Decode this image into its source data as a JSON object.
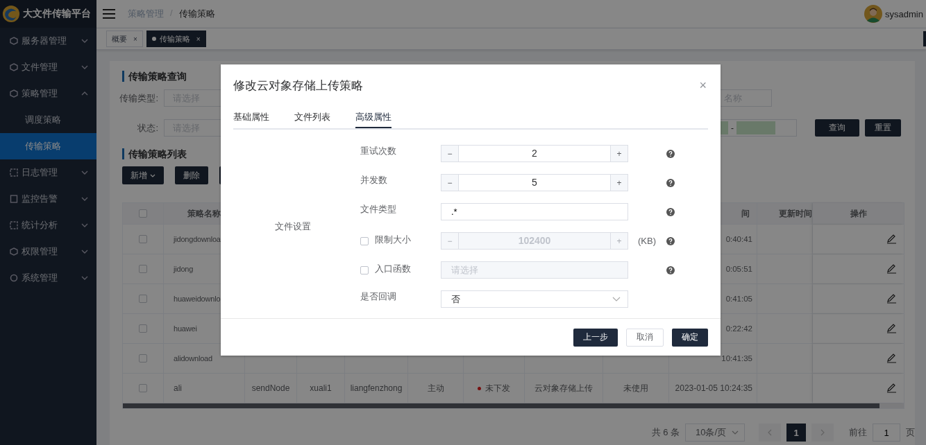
{
  "app": {
    "title": "大文件传输平台"
  },
  "sidebar": {
    "items": [
      {
        "label": "服务器管理",
        "expanded": false
      },
      {
        "label": "文件管理",
        "expanded": false
      },
      {
        "label": "策略管理",
        "expanded": true,
        "children": [
          {
            "label": "调度策略",
            "selected": false
          },
          {
            "label": "传输策略",
            "selected": true
          }
        ]
      },
      {
        "label": "日志管理",
        "expanded": false
      },
      {
        "label": "监控告警",
        "expanded": false
      },
      {
        "label": "统计分析",
        "expanded": false
      },
      {
        "label": "权限管理",
        "expanded": false
      },
      {
        "label": "系统管理",
        "expanded": false
      }
    ]
  },
  "header": {
    "breadcrumb": [
      "策略管理",
      "传输策略"
    ],
    "separator": "/",
    "user": "sysadmin"
  },
  "page_tabs": [
    {
      "label": "概要",
      "selected": false,
      "close": "×"
    },
    {
      "label": "传输策略",
      "selected": true,
      "close": "×"
    }
  ],
  "query": {
    "title": "传输策略查询",
    "type_label": "传输类型:",
    "type_placeholder": "请选择",
    "status_label": "状态:",
    "status_placeholder": "请选择",
    "name_placeholder": "名称",
    "range_separator": "-",
    "buttons": [
      "查询",
      "重置"
    ]
  },
  "list": {
    "title": "传输策略列表",
    "buttons": [
      {
        "label": "新增",
        "menu": true,
        "kind": "dark"
      },
      {
        "label": "删除",
        "menu": false,
        "kind": "dark"
      },
      {
        "kind": "dark"
      }
    ]
  },
  "table": {
    "header": {
      "name": "策略名称",
      "column_10": "间",
      "column_11": "更新时间",
      "column_12": "操作"
    },
    "all_selected": false,
    "rows": [
      {
        "selected": false,
        "name": "jidongdownloa",
        "column_10": "0:40:41"
      },
      {
        "selected": false,
        "name": "jidong",
        "column_10": "0:05:51"
      },
      {
        "selected": false,
        "name": "huaweidownlo",
        "column_10": "0:41:05"
      },
      {
        "selected": false,
        "name": "huawei",
        "column_10": "0:22:42"
      },
      {
        "selected": false,
        "name": "alidownload",
        "column_10": "10:41:35"
      },
      {
        "selected": false,
        "name": "ali",
        "column_3": "sendNode",
        "column_4": "xuali1",
        "column_5": "liangfenzhong",
        "column_6": "主动",
        "column_7": "未下发",
        "column_8": "云对象存储上传",
        "column_9": "未使用",
        "column_10": "2023-01-05 10:24:35"
      }
    ]
  },
  "pagination": {
    "total": "共 6 条",
    "page_size": "10条/页",
    "pages": [
      {
        "label": "1",
        "selected": true
      }
    ],
    "goto_label": "前往",
    "goto_value": "1",
    "goto_suffix": "页"
  },
  "dialog": {
    "title": "修改云对象存储上传策略",
    "close": "×",
    "tabs": [
      {
        "label": "基础属性",
        "selected": false
      },
      {
        "label": "文件列表",
        "selected": false
      },
      {
        "label": "高级属性",
        "selected": true
      }
    ],
    "group_label": "文件设置",
    "rows": [
      {
        "kind": "stepper",
        "label": "重试次数",
        "value": "2",
        "disabled": false,
        "minus": "−",
        "plus": "+",
        "help": true
      },
      {
        "kind": "stepper",
        "label": "并发数",
        "value": "5",
        "disabled": false,
        "minus": "−",
        "plus": "+",
        "help": true
      },
      {
        "kind": "input",
        "label": "文件类型",
        "value": ".*",
        "disabled": false,
        "help": true
      },
      {
        "kind": "stepper",
        "label": "限制大小",
        "checked": false,
        "value": "102400",
        "disabled": true,
        "unit": "(KB)",
        "minus": "−",
        "plus": "+",
        "help": true
      },
      {
        "kind": "select",
        "label": "入口函数",
        "checked": false,
        "placeholder": "请选择",
        "disabled": true,
        "help": true
      },
      {
        "kind": "select",
        "label": "是否回调",
        "value": "否",
        "disabled": false,
        "help": false
      }
    ],
    "buttons": [
      {
        "label": "上一步",
        "kind": "primary"
      },
      {
        "label": "取消",
        "kind": "plain"
      },
      {
        "label": "确定",
        "kind": "primary"
      }
    ]
  }
}
